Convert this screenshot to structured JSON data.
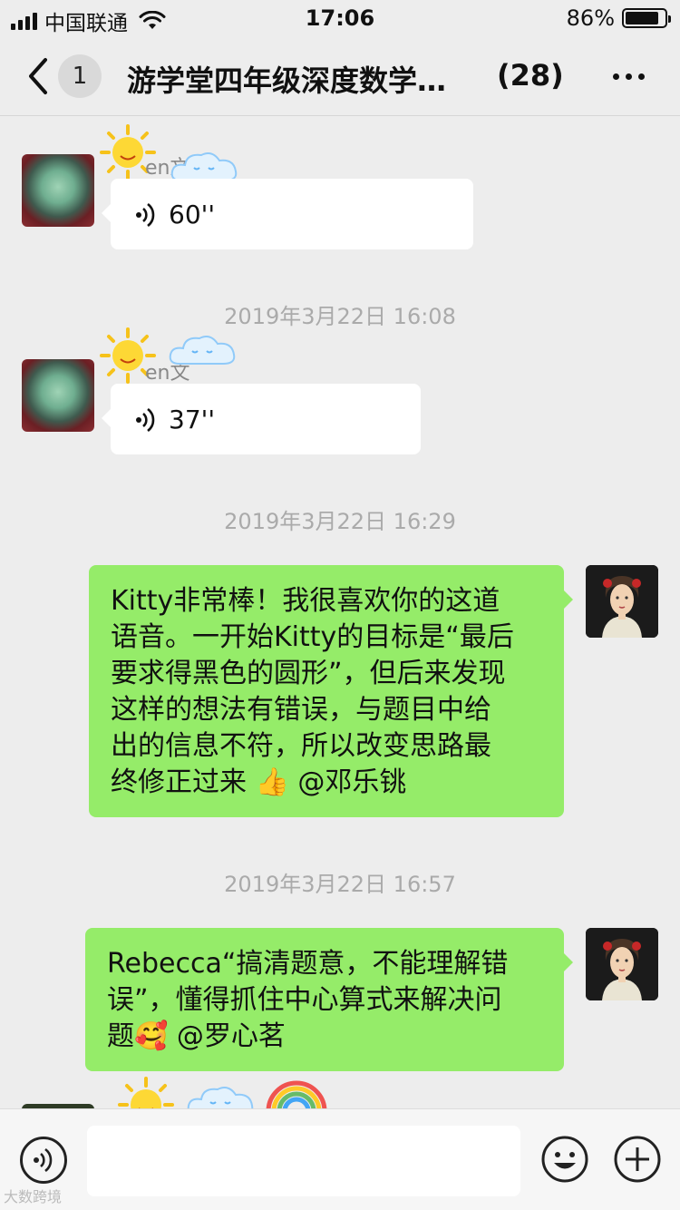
{
  "status_bar": {
    "carrier": "中国联通",
    "time": "17:06",
    "battery_percent": "86%",
    "battery_level": 0.86
  },
  "nav": {
    "unread_count": "1",
    "title": "游学堂四年级深度数学…",
    "member_count": "(28)"
  },
  "messages": {
    "m1": {
      "sender": "en文",
      "voice_duration": "60''"
    },
    "ts1": "2019年3月22日 16:08",
    "m2": {
      "sender": "en文",
      "voice_duration": "37''"
    },
    "ts2": "2019年3月22日 16:29",
    "m3": {
      "lines": [
        "Kitty非常棒！我很喜欢你的这道",
        "语音。一开始Kitty的目标是“最后",
        "要求得黑色的圆形”，但后来发现",
        "这样的想法有错误，与题目中给",
        "出的信息不符，所以改变思路最",
        "终修正过来 👍 @邓乐铫"
      ]
    },
    "ts3": "2019年3月22日 16:57",
    "m4": {
      "lines": [
        "Rebecca“搞清题意，不能理解错",
        "误”，懂得抓住中心算式来解决问",
        "题🥰 @罗心茗"
      ]
    }
  },
  "watermark": "大数跨境",
  "colors": {
    "bubble_green": "#95ec69",
    "bubble_white": "#ffffff",
    "background": "#ededed"
  }
}
